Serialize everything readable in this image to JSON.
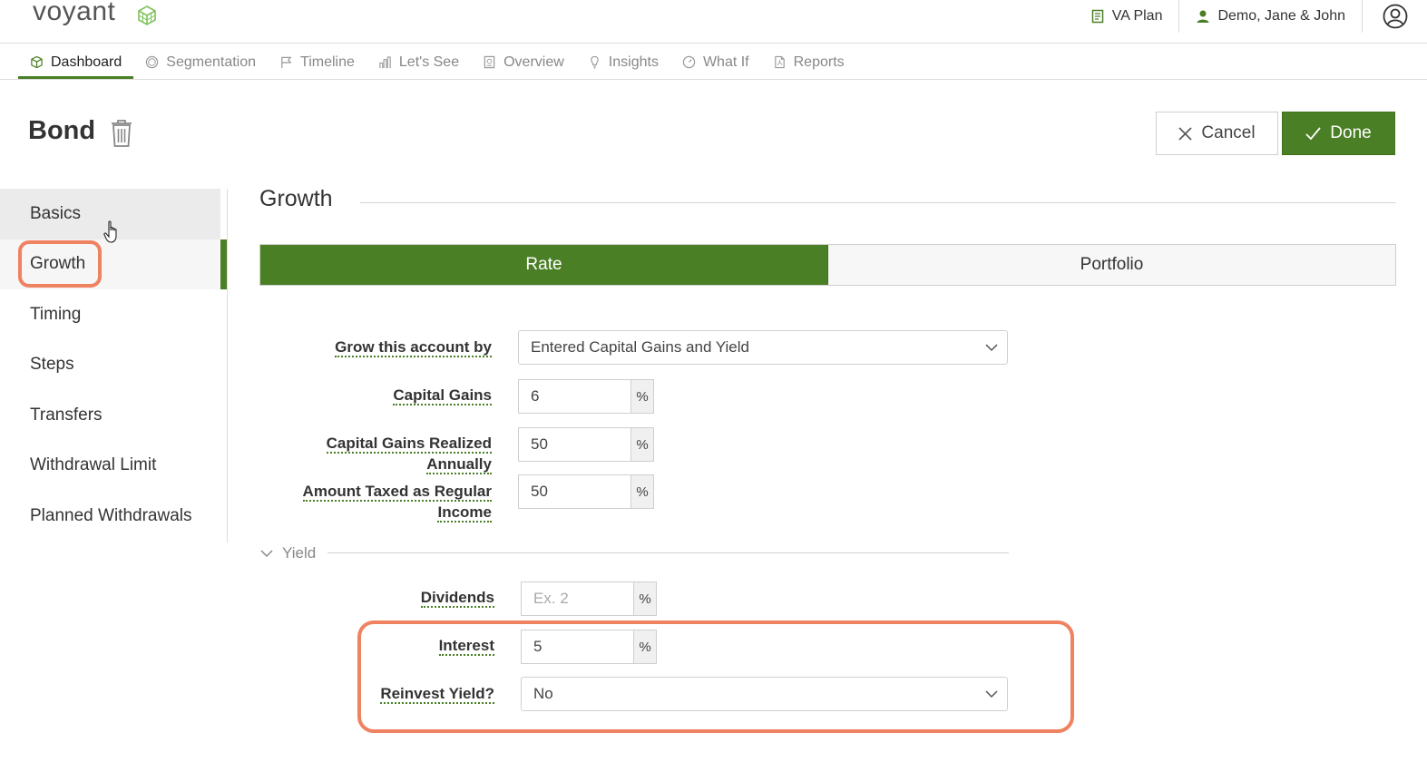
{
  "header": {
    "logo_text": "voyant",
    "plan_label": "VA Plan",
    "client_label": "Demo, Jane & John"
  },
  "nav": {
    "tabs": [
      {
        "label": "Dashboard",
        "active": true
      },
      {
        "label": "Segmentation"
      },
      {
        "label": "Timeline"
      },
      {
        "label": "Let's See"
      },
      {
        "label": "Overview"
      },
      {
        "label": "Insights"
      },
      {
        "label": "What If"
      },
      {
        "label": "Reports"
      }
    ]
  },
  "page": {
    "title": "Bond",
    "cancel_label": "Cancel",
    "done_label": "Done"
  },
  "side_menu": {
    "items": [
      "Basics",
      "Growth",
      "Timing",
      "Steps",
      "Transfers",
      "Withdrawal Limit",
      "Planned Withdrawals"
    ],
    "active": "Growth",
    "hovered": "Basics"
  },
  "growth": {
    "section_title": "Growth",
    "toggle": {
      "rate": "Rate",
      "portfolio": "Portfolio",
      "selected": "Rate"
    },
    "grow_label": "Grow this account by",
    "grow_value": "Entered Capital Gains and Yield",
    "capital_gains_label": "Capital Gains",
    "capital_gains_value": "6",
    "cg_realized_label": "Capital Gains Realized Annually",
    "cg_realized_value": "50",
    "taxed_label_1": "Amount Taxed as Regular",
    "taxed_label_2": "Income",
    "taxed_value": "50",
    "percent": "%",
    "yield_label": "Yield",
    "dividends_label": "Dividends",
    "dividends_placeholder": "Ex. 2",
    "interest_label": "Interest",
    "interest_value": "5",
    "reinvest_label": "Reinvest Yield?",
    "reinvest_value": "No"
  },
  "colors": {
    "accent": "#4a7f25",
    "highlight": "#ee8261"
  }
}
